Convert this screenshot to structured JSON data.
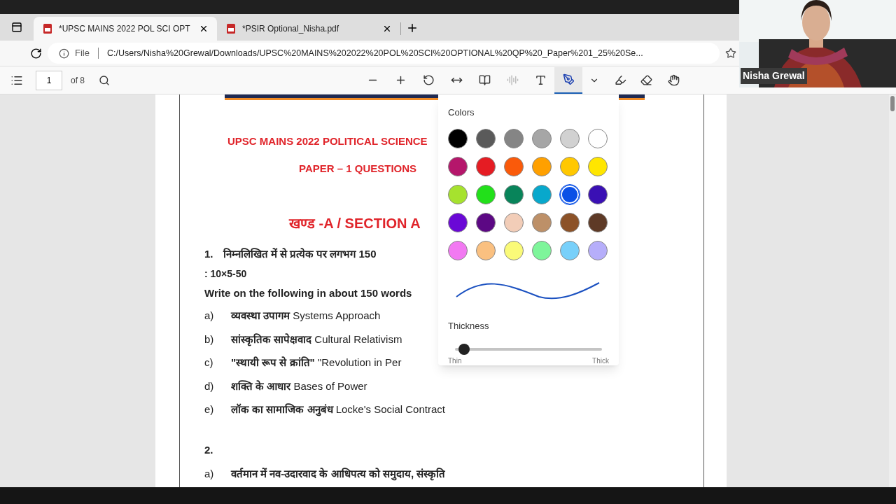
{
  "tabs": [
    {
      "title": "*UPSC MAINS 2022 POL SCI OPT",
      "selected": true
    },
    {
      "title": "*PSIR Optional_Nisha.pdf",
      "selected": false
    }
  ],
  "address": {
    "scheme": "File",
    "url": "C:/Users/Nisha%20Grewal/Downloads/UPSC%20MAINS%202022%20POL%20SCI%20OPTIONAL%20QP%20_Paper%201_25%20Se..."
  },
  "pdf_toolbar": {
    "page": "1",
    "page_count": "of 8",
    "tools": [
      {
        "selected": false
      },
      {
        "selected": false
      },
      {
        "selected": false
      },
      {
        "selected": false
      },
      {
        "selected": false
      },
      {
        "selected": false
      },
      {
        "selected": false
      },
      {
        "selected": true
      },
      {
        "selected": false
      },
      {
        "selected": false
      },
      {
        "selected": false
      }
    ]
  },
  "document": {
    "title": "UPSC MAINS 2022 POLITICAL SCIENCE",
    "subtitle": "PAPER – 1 QUESTIONS",
    "section": "खण्ड -A / SECTION A",
    "question_1": {
      "number": "1.",
      "text": "निम्नलिखित में से प्रत्येक पर लगभग 150",
      "marks": ": 10×5-50",
      "english": "Write on the following in about 150 words"
    },
    "items": [
      {
        "label": "a)",
        "text": "**व्यवस्था उपागम** Systems Approach"
      },
      {
        "label": "b)",
        "text": "**सांस्कृतिक सापेक्षवाद** Cultural Relativism"
      },
      {
        "label": "c)",
        "text": "**\"स्थायी रूप से क्रांति\"** \"Revolution in Per"
      },
      {
        "label": "d)",
        "text": "**शक्ति के आधार** Bases of Power"
      },
      {
        "label": "e)",
        "text": "**लॉक का सामाजिक अनुबंध** Locke's Social Contract"
      }
    ],
    "question_2": {
      "number": "2.",
      "items": [
        {
          "label": "a)",
          "text": "वर्तमान में नव-उदारवाद के आधिपत्य को समुदाय, संस्कृति"
        }
      ]
    }
  },
  "ink_popup": {
    "colors_label": "Colors",
    "swatches": [
      {
        "color": "#000000",
        "selected": false
      },
      {
        "color": "#5a5a5a",
        "selected": false
      },
      {
        "color": "#858585",
        "selected": false
      },
      {
        "color": "#a6a6a6",
        "selected": false
      },
      {
        "color": "#d1d1d1",
        "selected": false
      },
      {
        "color": "#ffffff",
        "selected": false
      },
      {
        "color": "#b5166b",
        "selected": false
      },
      {
        "color": "#e51c23",
        "selected": false
      },
      {
        "color": "#fa5a0a",
        "selected": false
      },
      {
        "color": "#ffa000",
        "selected": false
      },
      {
        "color": "#ffc800",
        "selected": false
      },
      {
        "color": "#ffe600",
        "selected": false
      },
      {
        "color": "#a6e22e",
        "selected": false
      },
      {
        "color": "#22e01a",
        "selected": false
      },
      {
        "color": "#08845a",
        "selected": false
      },
      {
        "color": "#08a8cc",
        "selected": false
      },
      {
        "color": "#0a50e6",
        "selected": true
      },
      {
        "color": "#3a10b4",
        "selected": false
      },
      {
        "color": "#6a08d6",
        "selected": false
      },
      {
        "color": "#5c0884",
        "selected": false
      },
      {
        "color": "#f2cdb8",
        "selected": false
      },
      {
        "color": "#bd9068",
        "selected": false
      },
      {
        "color": "#8c5228",
        "selected": false
      },
      {
        "color": "#5e3a26",
        "selected": false
      },
      {
        "color": "#f279f2",
        "selected": false
      },
      {
        "color": "#fac080",
        "selected": false
      },
      {
        "color": "#fafa78",
        "selected": false
      },
      {
        "color": "#7ef59a",
        "selected": false
      },
      {
        "color": "#78d0fa",
        "selected": false
      },
      {
        "color": "#b6aefa",
        "selected": false
      }
    ],
    "thickness_label": "Thickness",
    "thickness": {
      "level": 0.03,
      "min_label": "Thin",
      "max_label": "Thick"
    }
  },
  "video": {
    "kind": "picture",
    "name": "Nisha Grewal"
  }
}
